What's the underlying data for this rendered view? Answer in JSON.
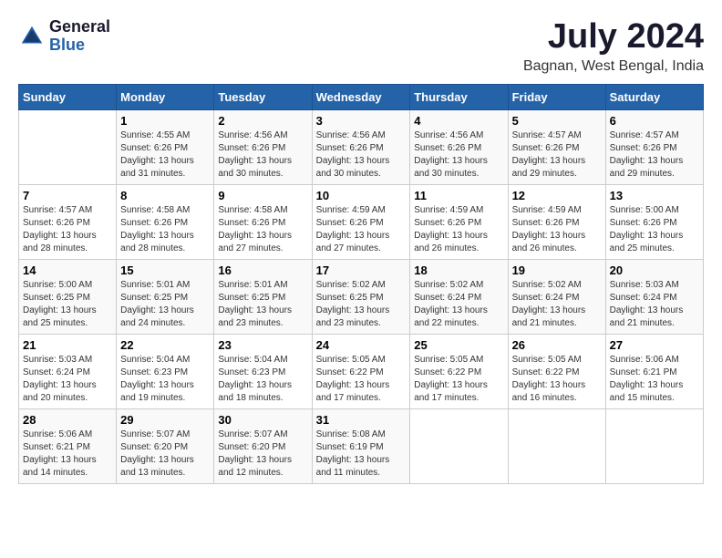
{
  "header": {
    "logo_general": "General",
    "logo_blue": "Blue",
    "month_title": "July 2024",
    "location": "Bagnan, West Bengal, India"
  },
  "days_of_week": [
    "Sunday",
    "Monday",
    "Tuesday",
    "Wednesday",
    "Thursday",
    "Friday",
    "Saturday"
  ],
  "weeks": [
    [
      {
        "num": "",
        "detail": ""
      },
      {
        "num": "1",
        "detail": "Sunrise: 4:55 AM\nSunset: 6:26 PM\nDaylight: 13 hours\nand 31 minutes."
      },
      {
        "num": "2",
        "detail": "Sunrise: 4:56 AM\nSunset: 6:26 PM\nDaylight: 13 hours\nand 30 minutes."
      },
      {
        "num": "3",
        "detail": "Sunrise: 4:56 AM\nSunset: 6:26 PM\nDaylight: 13 hours\nand 30 minutes."
      },
      {
        "num": "4",
        "detail": "Sunrise: 4:56 AM\nSunset: 6:26 PM\nDaylight: 13 hours\nand 30 minutes."
      },
      {
        "num": "5",
        "detail": "Sunrise: 4:57 AM\nSunset: 6:26 PM\nDaylight: 13 hours\nand 29 minutes."
      },
      {
        "num": "6",
        "detail": "Sunrise: 4:57 AM\nSunset: 6:26 PM\nDaylight: 13 hours\nand 29 minutes."
      }
    ],
    [
      {
        "num": "7",
        "detail": "Sunrise: 4:57 AM\nSunset: 6:26 PM\nDaylight: 13 hours\nand 28 minutes."
      },
      {
        "num": "8",
        "detail": "Sunrise: 4:58 AM\nSunset: 6:26 PM\nDaylight: 13 hours\nand 28 minutes."
      },
      {
        "num": "9",
        "detail": "Sunrise: 4:58 AM\nSunset: 6:26 PM\nDaylight: 13 hours\nand 27 minutes."
      },
      {
        "num": "10",
        "detail": "Sunrise: 4:59 AM\nSunset: 6:26 PM\nDaylight: 13 hours\nand 27 minutes."
      },
      {
        "num": "11",
        "detail": "Sunrise: 4:59 AM\nSunset: 6:26 PM\nDaylight: 13 hours\nand 26 minutes."
      },
      {
        "num": "12",
        "detail": "Sunrise: 4:59 AM\nSunset: 6:26 PM\nDaylight: 13 hours\nand 26 minutes."
      },
      {
        "num": "13",
        "detail": "Sunrise: 5:00 AM\nSunset: 6:26 PM\nDaylight: 13 hours\nand 25 minutes."
      }
    ],
    [
      {
        "num": "14",
        "detail": "Sunrise: 5:00 AM\nSunset: 6:25 PM\nDaylight: 13 hours\nand 25 minutes."
      },
      {
        "num": "15",
        "detail": "Sunrise: 5:01 AM\nSunset: 6:25 PM\nDaylight: 13 hours\nand 24 minutes."
      },
      {
        "num": "16",
        "detail": "Sunrise: 5:01 AM\nSunset: 6:25 PM\nDaylight: 13 hours\nand 23 minutes."
      },
      {
        "num": "17",
        "detail": "Sunrise: 5:02 AM\nSunset: 6:25 PM\nDaylight: 13 hours\nand 23 minutes."
      },
      {
        "num": "18",
        "detail": "Sunrise: 5:02 AM\nSunset: 6:24 PM\nDaylight: 13 hours\nand 22 minutes."
      },
      {
        "num": "19",
        "detail": "Sunrise: 5:02 AM\nSunset: 6:24 PM\nDaylight: 13 hours\nand 21 minutes."
      },
      {
        "num": "20",
        "detail": "Sunrise: 5:03 AM\nSunset: 6:24 PM\nDaylight: 13 hours\nand 21 minutes."
      }
    ],
    [
      {
        "num": "21",
        "detail": "Sunrise: 5:03 AM\nSunset: 6:24 PM\nDaylight: 13 hours\nand 20 minutes."
      },
      {
        "num": "22",
        "detail": "Sunrise: 5:04 AM\nSunset: 6:23 PM\nDaylight: 13 hours\nand 19 minutes."
      },
      {
        "num": "23",
        "detail": "Sunrise: 5:04 AM\nSunset: 6:23 PM\nDaylight: 13 hours\nand 18 minutes."
      },
      {
        "num": "24",
        "detail": "Sunrise: 5:05 AM\nSunset: 6:22 PM\nDaylight: 13 hours\nand 17 minutes."
      },
      {
        "num": "25",
        "detail": "Sunrise: 5:05 AM\nSunset: 6:22 PM\nDaylight: 13 hours\nand 17 minutes."
      },
      {
        "num": "26",
        "detail": "Sunrise: 5:05 AM\nSunset: 6:22 PM\nDaylight: 13 hours\nand 16 minutes."
      },
      {
        "num": "27",
        "detail": "Sunrise: 5:06 AM\nSunset: 6:21 PM\nDaylight: 13 hours\nand 15 minutes."
      }
    ],
    [
      {
        "num": "28",
        "detail": "Sunrise: 5:06 AM\nSunset: 6:21 PM\nDaylight: 13 hours\nand 14 minutes."
      },
      {
        "num": "29",
        "detail": "Sunrise: 5:07 AM\nSunset: 6:20 PM\nDaylight: 13 hours\nand 13 minutes."
      },
      {
        "num": "30",
        "detail": "Sunrise: 5:07 AM\nSunset: 6:20 PM\nDaylight: 13 hours\nand 12 minutes."
      },
      {
        "num": "31",
        "detail": "Sunrise: 5:08 AM\nSunset: 6:19 PM\nDaylight: 13 hours\nand 11 minutes."
      },
      {
        "num": "",
        "detail": ""
      },
      {
        "num": "",
        "detail": ""
      },
      {
        "num": "",
        "detail": ""
      }
    ]
  ]
}
